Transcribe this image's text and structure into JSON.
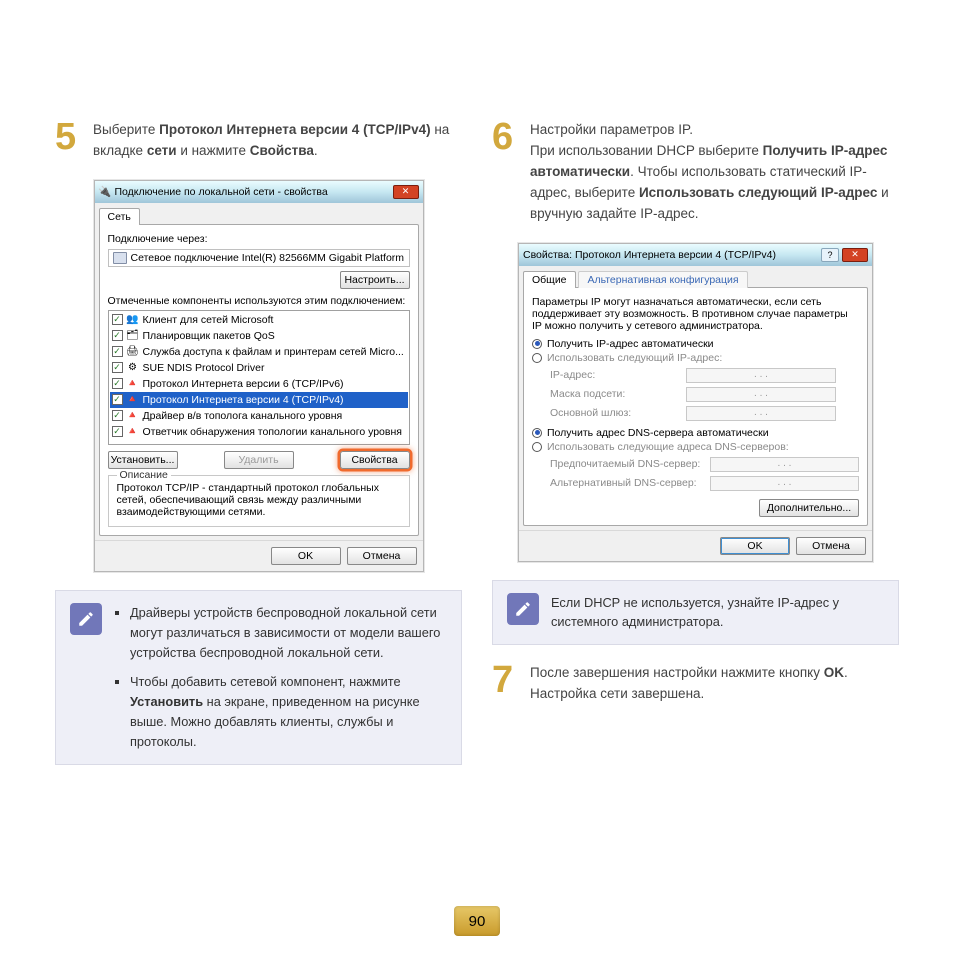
{
  "page_number": "90",
  "step5": {
    "num": "5",
    "pre": "Выберите ",
    "b1": "Протокол Интернета версии 4 (TCP/IPv4)",
    "mid": " на вкладке ",
    "b2": "сети",
    "mid2": " и нажмите ",
    "b3": "Свойства",
    "end": "."
  },
  "step6": {
    "num": "6",
    "l1": "Настройки параметров IP.",
    "l2a": "При использовании DHCP выберите ",
    "l2b": "Получить IP-адрес автоматически",
    "l2c": ". Чтобы использовать статический IP-адрес, выберите ",
    "l2d": "Использовать следующий IP-адрес",
    "l2e": " и вручную задайте IP-адрес."
  },
  "step7": {
    "num": "7",
    "a": "После завершения настройки нажмите кнопку ",
    "b": "OK",
    "c": ". Настройка сети завершена."
  },
  "dlg1": {
    "title": "Подключение по локальной сети - свойства",
    "tab": "Сеть",
    "conn_via": "Подключение через:",
    "nic": "Сетевое подключение Intel(R) 82566MM Gigabit Platform",
    "configure": "Настроить...",
    "components_label": "Отмеченные компоненты используются этим подключением:",
    "items": [
      {
        "icon": "👥",
        "label": "Клиент для сетей Microsoft"
      },
      {
        "icon": "🗂",
        "label": "Планировщик пакетов QoS"
      },
      {
        "icon": "🖨",
        "label": "Служба доступа к файлам и принтерам сетей Micro..."
      },
      {
        "icon": "⚙",
        "label": "SUE NDIS Protocol Driver"
      },
      {
        "icon": "🔺",
        "label": "Протокол Интернета версии 6 (TCP/IPv6)"
      },
      {
        "icon": "🔺",
        "label": "Протокол Интернета версии 4 (TCP/IPv4)"
      },
      {
        "icon": "🔺",
        "label": "Драйвер в/в тополога канального уровня"
      },
      {
        "icon": "🔺",
        "label": "Ответчик обнаружения топологии канального уровня"
      }
    ],
    "install": "Установить...",
    "uninstall": "Удалить",
    "properties": "Свойства",
    "desc_title": "Описание",
    "desc": "Протокол TCP/IP - стандартный протокол глобальных сетей, обеспечивающий связь между различными взаимодействующими сетями.",
    "ok": "OK",
    "cancel": "Отмена"
  },
  "dlg2": {
    "title": "Свойства: Протокол Интернета версии 4 (TCP/IPv4)",
    "tab_general": "Общие",
    "tab_alt": "Альтернативная конфигурация",
    "blurb": "Параметры IP могут назначаться автоматически, если сеть поддерживает эту возможность. В противном случае параметры IP можно получить у сетевого администратора.",
    "r1": "Получить IP-адрес автоматически",
    "r2": "Использовать следующий IP-адрес:",
    "ip": "IP-адрес:",
    "mask": "Маска подсети:",
    "gw": "Основной шлюз:",
    "r3": "Получить адрес DNS-сервера автоматически",
    "r4": "Использовать следующие адреса DNS-серверов:",
    "dns1": "Предпочитаемый DNS-сервер:",
    "dns2": "Альтернативный DNS-сервер:",
    "dots": ".       .       .",
    "advanced": "Дополнительно...",
    "ok": "OK",
    "cancel": "Отмена"
  },
  "note1": {
    "b1": "Драйверы устройств беспроводной локальной сети могут различаться в зависимости от модели вашего устройства беспроводной локальной сети.",
    "b2a": "Чтобы добавить сетевой компонент, нажмите ",
    "b2b": "Установить",
    "b2c": " на экране, приведенном на рисунке выше. Можно добавлять клиенты, службы и протоколы."
  },
  "note2": {
    "text": "Если DHCP не используется, узнайте IP-адрес у системного администратора."
  }
}
